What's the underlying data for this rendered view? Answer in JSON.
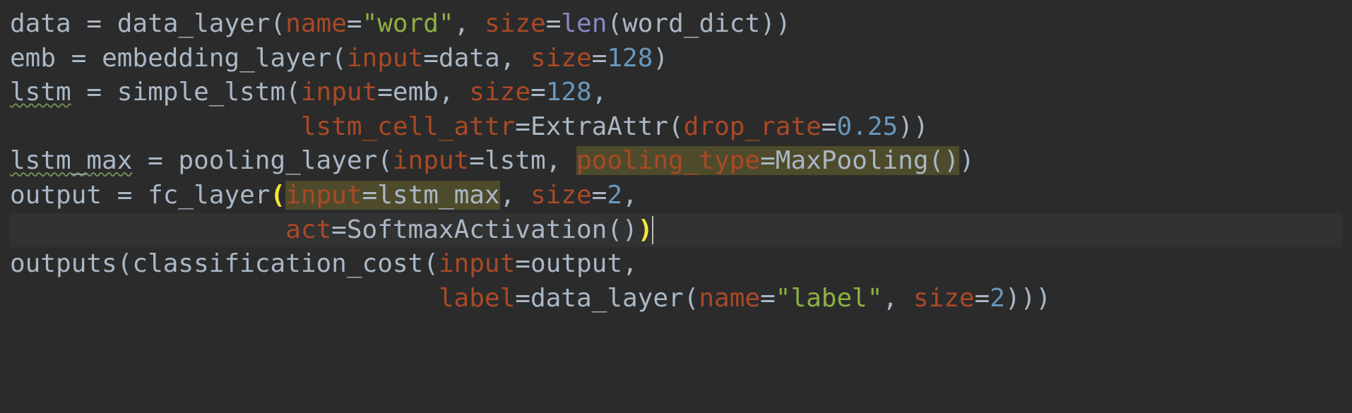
{
  "code": {
    "l1": {
      "v_data": "data",
      "eq": " = ",
      "fn": "data_layer",
      "op": "(",
      "kw_name": "name",
      "eq2": "=",
      "str_word": "\"word\"",
      "comma": ", ",
      "kw_size": "size",
      "eq3": "=",
      "builtin_len": "len",
      "op2": "(",
      "arg_wd": "word_dict",
      "cp": "))"
    },
    "l2": {
      "v_emb": "emb",
      "eq": " = ",
      "fn": "embedding_layer",
      "op": "(",
      "kw_input": "input",
      "eq2": "=",
      "arg_data": "data",
      "comma": ", ",
      "kw_size": "size",
      "eq3": "=",
      "num": "128",
      "cp": ")"
    },
    "l3": {
      "v_lstm": "lstm",
      "eq": " = ",
      "fn": "simple_lstm",
      "op": "(",
      "kw_input": "input",
      "eq2": "=",
      "arg_emb": "emb",
      "comma": ", ",
      "kw_size": "size",
      "eq3": "=",
      "num": "128",
      "comma2": ","
    },
    "l4": {
      "indent": "                   ",
      "kw_attr": "lstm_cell_attr",
      "eq": "=",
      "cls": "ExtraAttr",
      "op": "(",
      "kw_dr": "drop_rate",
      "eq2": "=",
      "num": "0.25",
      "cp": "))"
    },
    "l5": {
      "v_lm": "lstm_max",
      "eq": " = ",
      "fn": "pooling_layer",
      "op": "(",
      "kw_input": "input",
      "eq2": "=",
      "arg_lstm": "lstm",
      "comma": ", ",
      "kw_pt": "pooling_type",
      "eq3": "=",
      "cls": "MaxPooling",
      "pp": "()",
      "cp": ")"
    },
    "l6": {
      "v_out": "output",
      "eq": " = ",
      "fn": "fc_layer",
      "op": "(",
      "kw_input": "input",
      "eq2": "=",
      "arg_lm": "lstm_max",
      "comma": ", ",
      "kw_size": "size",
      "eq3": "=",
      "num": "2",
      "comma2": ","
    },
    "l7": {
      "indent": "                  ",
      "kw_act": "act",
      "eq": "=",
      "cls": "SoftmaxActivation",
      "pp": "()",
      "cp": ")"
    },
    "l8": {
      "fn": "outputs",
      "op": "(",
      "fn2": "classification_cost",
      "op2": "(",
      "kw_input": "input",
      "eq": "=",
      "arg_out": "output",
      "comma": ","
    },
    "l9": {
      "indent": "                            ",
      "kw_label": "label",
      "eq": "=",
      "fn": "data_layer",
      "op": "(",
      "kw_name": "name",
      "eq2": "=",
      "str_label": "\"label\"",
      "comma": ", ",
      "kw_size": "size",
      "eq3": "=",
      "num": "2",
      "cp": ")))"
    }
  }
}
